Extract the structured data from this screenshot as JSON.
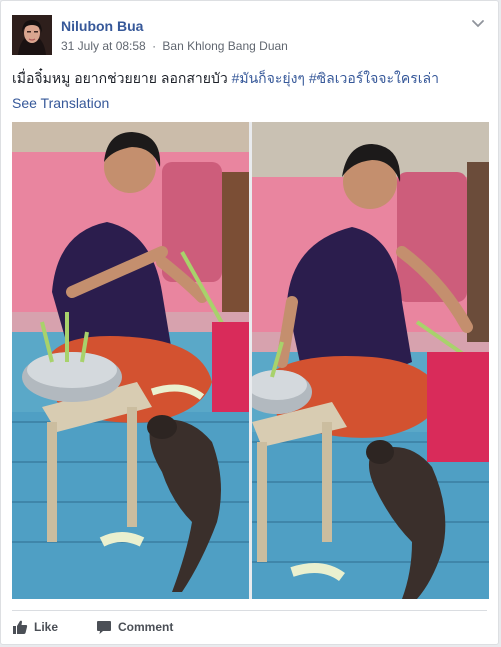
{
  "post": {
    "author": "Nilubon Bua",
    "date": "31 July at 08:58",
    "separator": "·",
    "location": "Ban Khlong Bang Duan",
    "text_main": "เมื่อจิ๋มหมู อยากช่วยยาย ลอกสายบัว ",
    "hashtags": [
      "#มันก็จะยุ่งๆ",
      "#ซิลเวอร์ใจจะใครเล่า"
    ],
    "see_translation": "See Translation"
  },
  "actions": {
    "like": "Like",
    "comment": "Comment"
  },
  "icons": {
    "options": "chevron-down-icon",
    "like": "thumbs-up-icon",
    "comment": "speech-bubble-icon"
  },
  "colors": {
    "link": "#365899",
    "meta": "#616770",
    "action_text": "#4b4f56"
  }
}
